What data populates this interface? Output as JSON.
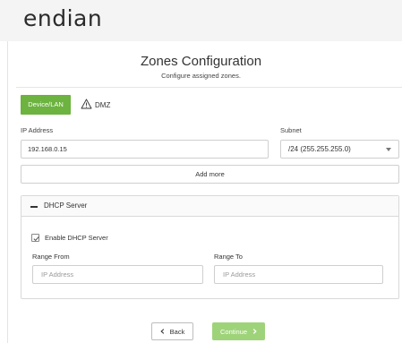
{
  "app": {
    "logo_text": "endian"
  },
  "page": {
    "title": "Zones Configuration",
    "subtitle": "Configure assigned zones."
  },
  "tabs": [
    {
      "label": "Device/LAN",
      "active": true
    },
    {
      "label": "DMZ",
      "active": false,
      "icon": "warning-icon"
    }
  ],
  "network": {
    "ip_label": "IP Address",
    "ip_value": "192.168.0.15",
    "subnet_label": "Subnet",
    "subnet_value": "/24 (255.255.255.0)",
    "add_more_label": "Add more"
  },
  "dhcp": {
    "panel_title": "DHCP Server",
    "enable_label": "Enable DHCP Server",
    "enabled": true,
    "range_from_label": "Range From",
    "range_from_placeholder": "IP Address",
    "range_to_label": "Range To",
    "range_to_placeholder": "IP Address"
  },
  "actions": {
    "back_label": "Back",
    "continue_label": "Continue"
  },
  "colors": {
    "accent": "#6cb33f",
    "accent_disabled": "#9fd37a"
  }
}
